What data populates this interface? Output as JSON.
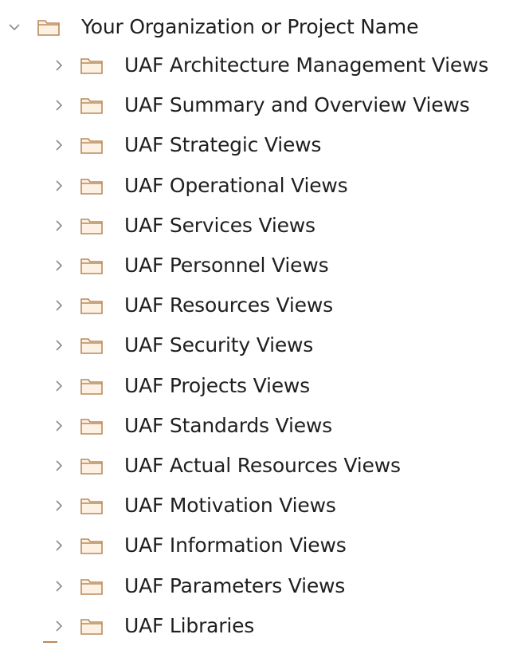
{
  "tree": {
    "root": {
      "label": "Your Organization or Project Name",
      "expanded": true,
      "icon": "folder-icon",
      "expander_icon": "chevron-down-icon"
    },
    "children": [
      {
        "label": "UAF Architecture Management Views"
      },
      {
        "label": "UAF Summary and Overview Views"
      },
      {
        "label": "UAF Strategic Views"
      },
      {
        "label": "UAF Operational Views"
      },
      {
        "label": "UAF Services Views"
      },
      {
        "label": "UAF Personnel Views"
      },
      {
        "label": "UAF Resources Views"
      },
      {
        "label": "UAF Security Views"
      },
      {
        "label": "UAF Projects Views"
      },
      {
        "label": "UAF Standards Views"
      },
      {
        "label": "UAF Actual Resources Views"
      },
      {
        "label": "UAF Motivation Views"
      },
      {
        "label": "UAF Information Views"
      },
      {
        "label": "UAF Parameters Views"
      },
      {
        "label": "UAF Libraries"
      }
    ],
    "child_expander_icon": "chevron-right-icon",
    "child_icon": "folder-icon"
  },
  "colors": {
    "folder_stroke": "#b98a5a",
    "folder_fill": "#fdf1e4",
    "chevron": "#8a8a8a",
    "text": "#1f1f1f"
  }
}
